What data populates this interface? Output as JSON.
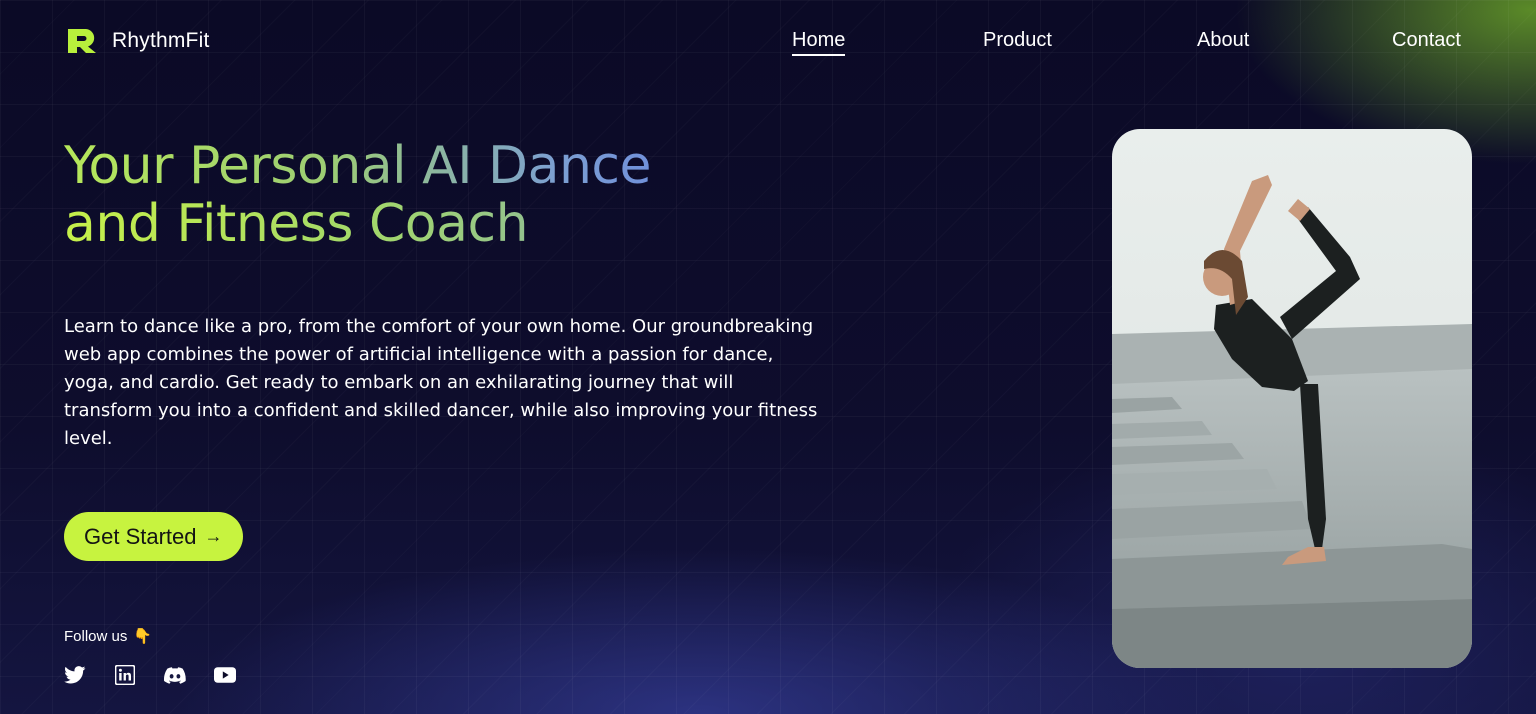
{
  "brand": {
    "name": "RhythmFit",
    "accent_color": "#c7f33f"
  },
  "nav": {
    "items": [
      {
        "label": "Home",
        "active": true
      },
      {
        "label": "Product",
        "active": false
      },
      {
        "label": "About",
        "active": false
      },
      {
        "label": "Contact",
        "active": false
      }
    ]
  },
  "hero": {
    "title_line1": "Your Personal AI Dance",
    "title_line2": "and Fitness Coach",
    "description": "Learn to dance like a pro, from the comfort of your own home. Our groundbreaking web app combines the power of artificial intelligence with a passion for dance, yoga, and cardio. Get ready to embark on an exhilarating journey that will transform you into a confident and skilled dancer, while also improving your fitness level.",
    "cta_label": "Get Started",
    "cta_arrow": "→"
  },
  "follow": {
    "label": "Follow us",
    "emoji": "👇",
    "socials": [
      {
        "icon": "twitter-icon"
      },
      {
        "icon": "linkedin-icon"
      },
      {
        "icon": "discord-icon"
      },
      {
        "icon": "youtube-icon"
      }
    ]
  },
  "image": {
    "subject": "woman-yoga-pose-photo"
  }
}
